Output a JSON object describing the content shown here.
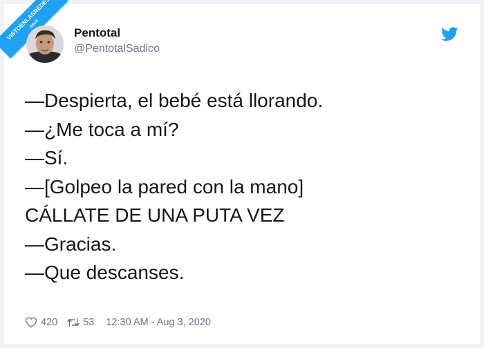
{
  "watermark": {
    "line1": "VISTOENLASREDES",
    "line2": ".com"
  },
  "profile": {
    "name": "Pentotal",
    "handle": "@PentotalSadico"
  },
  "tweet": {
    "lines": [
      "—Despierta, el bebé está llorando.",
      "—¿Me toca a mí?",
      "—Sí.",
      "—[Golpeo la pared con la mano]",
      "CÁLLATE DE UNA PUTA VEZ",
      "—Gracias.",
      "—Que descanses."
    ]
  },
  "meta": {
    "likes": "420",
    "retweets": "53",
    "timestamp": "12:30 AM - Aug 3, 2020"
  },
  "colors": {
    "twitter_blue": "#1da1f2",
    "text": "#14171a",
    "muted": "#657786"
  },
  "icons": [
    "twitter-bird-icon",
    "heart-icon",
    "retweet-icon"
  ]
}
